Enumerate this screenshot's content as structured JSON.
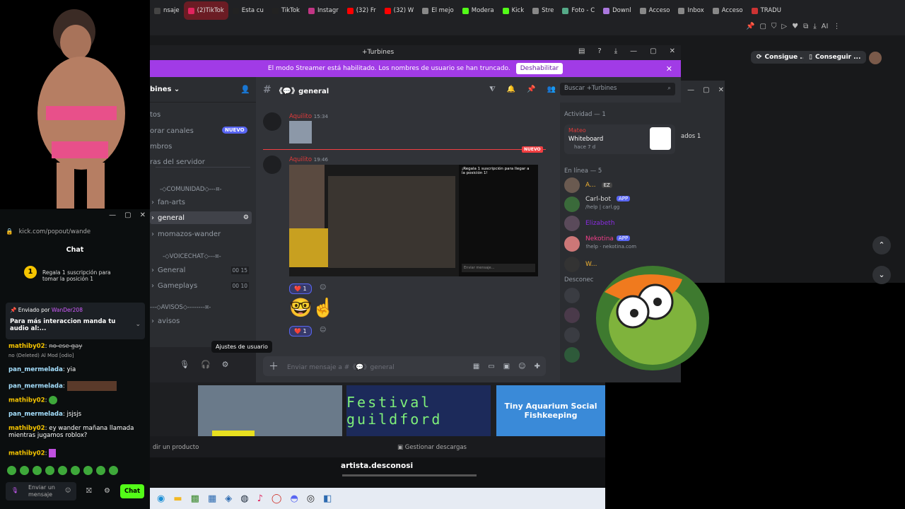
{
  "browser": {
    "tabs": [
      "nsaje",
      "(2)TikTok",
      "Esta cu",
      "TikTok",
      "Instagr",
      "(32) Fr",
      "(32) W",
      "El mejo",
      "Modera",
      "Kick",
      "Stre",
      "Foto - C",
      "Downl",
      "Acceso",
      "Inbox",
      "Acceso",
      "TRADU"
    ],
    "active_tab_index": 1,
    "right_buttons": [
      "Consigue ...",
      "Conseguir ..."
    ]
  },
  "discord": {
    "title": "+Turbines",
    "streamer_banner": "El modo Streamer está habilitado. Los nombres de usuario se han truncado.",
    "disable_button": "Deshabilitar",
    "server_name": "bines",
    "menu_items": [
      "tos",
      "orar canales",
      "mbros",
      "ras del servidor"
    ],
    "new_badge": "NUEVO",
    "categories": [
      "-◇COMUNIDAD◇---¤-",
      "-◇VOICECHAT◇---¤-",
      "---◇AVISOS◇--------¤-"
    ],
    "channels": [
      "fan-arts",
      "general",
      "momazos-wander",
      "General",
      "Gameplays",
      "avisos"
    ],
    "voice_counts": [
      [
        "00",
        "15"
      ],
      [
        "00",
        "10"
      ]
    ],
    "channel_header": "《💬》general",
    "search_placeholder": "Buscar +Turbines",
    "messages": [
      {
        "author": "Aquilito",
        "time": "15:34"
      },
      {
        "author": "Aquilito",
        "time": "19:46"
      }
    ],
    "new_divider": "NUEVO",
    "reactions": [
      "1",
      "1"
    ],
    "tooltip": "Ajustes de usuario",
    "input_placeholder": "Enviar mensaje a #《💬》general",
    "embed_chat_text": "¡Regala 1 suscripción para llegar a la posición 1!",
    "embed_input": "Enviar mensaje..."
  },
  "members": {
    "activity_header": "Actividad — 1",
    "activity_user": "Mateo",
    "activity_title": "Whiteboard",
    "activity_time": "hace 7 d",
    "online_header": "En línea — 5",
    "online": [
      {
        "name": "A...",
        "badge": "EZ"
      },
      {
        "name": "Carl-bot",
        "badge": "APP",
        "status": "/help | carl.gg"
      },
      {
        "name": "Elizabeth"
      },
      {
        "name": "Nekotina",
        "badge": "APP",
        "status": "!help · nekotina.com"
      },
      {
        "name": "W..."
      }
    ],
    "offline_header": "Desconec"
  },
  "side_window": {
    "text": "ados 1"
  },
  "ticker": {
    "games": [
      "",
      "Festival guildford",
      "Tiny Aquarium Social Fishkeeping"
    ]
  },
  "bottom_bar": {
    "left": "dir un producto",
    "right": "Gestionar descargas"
  },
  "kick": {
    "url": "kick.com/popout/wande",
    "title": "Chat",
    "promo": "Regala 1 suscripción para tomar la posición 1",
    "pinned_by": "Enviado por",
    "pinned_user": "WanDer208",
    "pinned_text": "Para más interaccion manda tu audio al:...",
    "messages": [
      {
        "user": "mathiby02",
        "text": "no ese gay"
      },
      {
        "user": "no (Deleted)",
        "text": "Al Mod [odio]"
      },
      {
        "user": "pan_mermelada",
        "text": "yia"
      },
      {
        "user": "pan_mermelada",
        "text": ""
      },
      {
        "user": "mathiby02",
        "text": ""
      },
      {
        "user": "pan_mermelada",
        "text": "jsjsjs"
      },
      {
        "user": "mathiby02",
        "text": "ey wander mañana llamada mientras jugamos roblox?"
      },
      {
        "user": "mathiby02",
        "text": ""
      }
    ],
    "input_placeholder": "Enviar un mensaje",
    "chat_button": "Chat"
  },
  "caption": "artista.desconosi"
}
